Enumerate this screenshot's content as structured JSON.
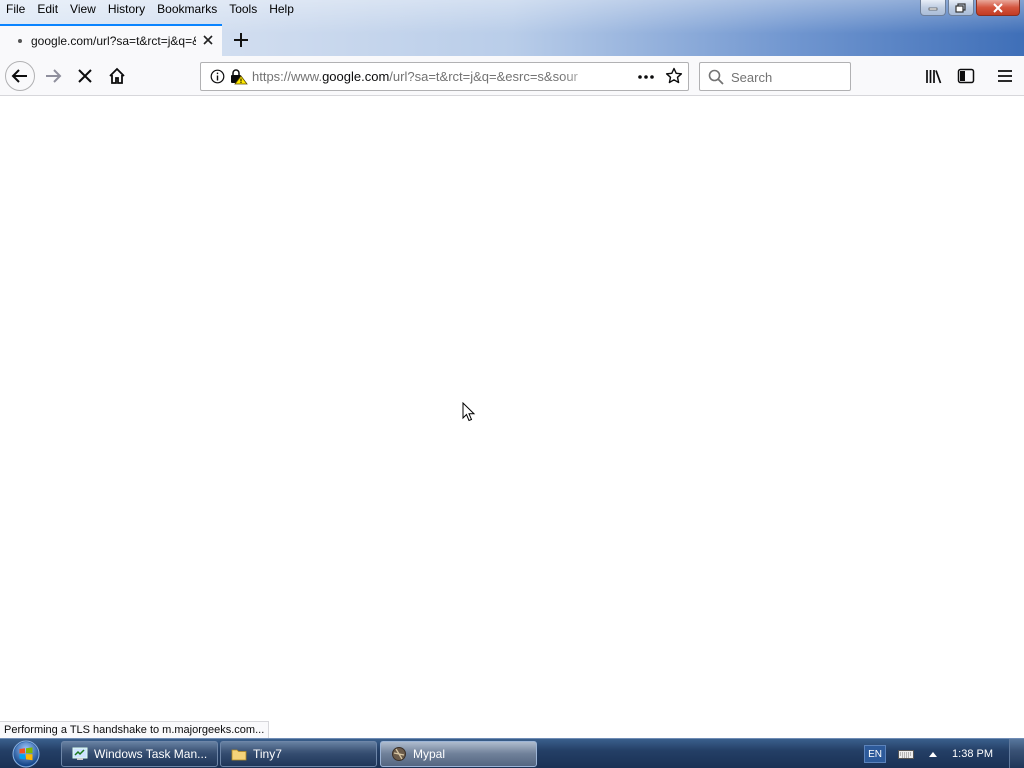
{
  "menu": {
    "items": [
      {
        "label": "File"
      },
      {
        "label": "Edit"
      },
      {
        "label": "View"
      },
      {
        "label": "History"
      },
      {
        "label": "Bookmarks"
      },
      {
        "label": "Tools"
      },
      {
        "label": "Help"
      }
    ]
  },
  "tab": {
    "title": "google.com/url?sa=t&rct=j&q=&esrc=s&sour",
    "loading": true
  },
  "navbar": {
    "url_prefix": "https://www.",
    "url_host": "google.com",
    "url_path": "/url?sa=t&rct=j&q=&esrc=s&sour",
    "search_placeholder": "Search",
    "page_actions_icon": "more-horizontal-icon"
  },
  "status": {
    "text": "Performing a TLS handshake to m.majorgeeks.com..."
  },
  "taskbar": {
    "buttons": [
      {
        "label": "Windows Task Man...",
        "icon": "task-manager-icon",
        "active": false
      },
      {
        "label": "Tiny7",
        "icon": "folder-icon",
        "active": false
      },
      {
        "label": "Mypal",
        "icon": "mypal-icon",
        "active": true
      }
    ],
    "language": "EN",
    "clock": "1:38 PM"
  },
  "colors": {
    "accent": "#0a84ff",
    "taskbar": "#243f66"
  }
}
